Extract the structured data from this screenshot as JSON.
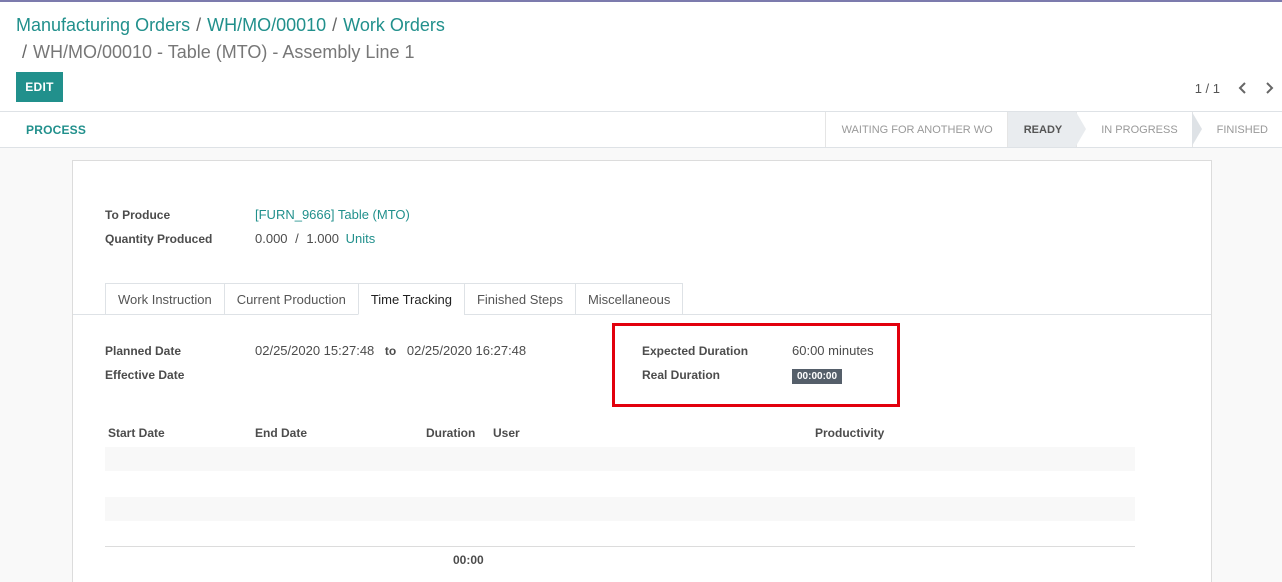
{
  "breadcrumb": {
    "items": [
      "Manufacturing Orders",
      "WH/MO/00010",
      "Work Orders"
    ],
    "current": "WH/MO/00010 - Table (MTO) - Assembly Line 1",
    "separator": "/"
  },
  "toolbar": {
    "edit_label": "EDIT"
  },
  "pager": {
    "value": "1 / 1"
  },
  "statusbar": {
    "process_label": "PROCESS",
    "stages": [
      "WAITING FOR ANOTHER WO",
      "READY",
      "IN PROGRESS",
      "FINISHED"
    ],
    "active_stage": "READY"
  },
  "form": {
    "to_produce_label": "To Produce",
    "to_produce_value": "[FURN_9666] Table (MTO)",
    "qty_label": "Quantity Produced",
    "qty_done": "0.000",
    "qty_sep": "/",
    "qty_total": "1.000",
    "qty_uom": "Units"
  },
  "tabs": [
    "Work Instruction",
    "Current Production",
    "Time Tracking",
    "Finished Steps",
    "Miscellaneous"
  ],
  "active_tab": "Time Tracking",
  "time_tracking": {
    "planned_label": "Planned Date",
    "planned_start": "02/25/2020 15:27:48",
    "to_word": "to",
    "planned_end": "02/25/2020 16:27:48",
    "effective_label": "Effective Date",
    "expected_label": "Expected Duration",
    "expected_value": "60:00 minutes",
    "real_label": "Real Duration",
    "real_value": "00:00:00",
    "columns": [
      "Start Date",
      "End Date",
      "Duration",
      "User",
      "Productivity"
    ],
    "total_duration": "00:00"
  },
  "colors": {
    "accent": "#21908c",
    "highlight": "#e2000d",
    "badge": "#555f6a"
  }
}
